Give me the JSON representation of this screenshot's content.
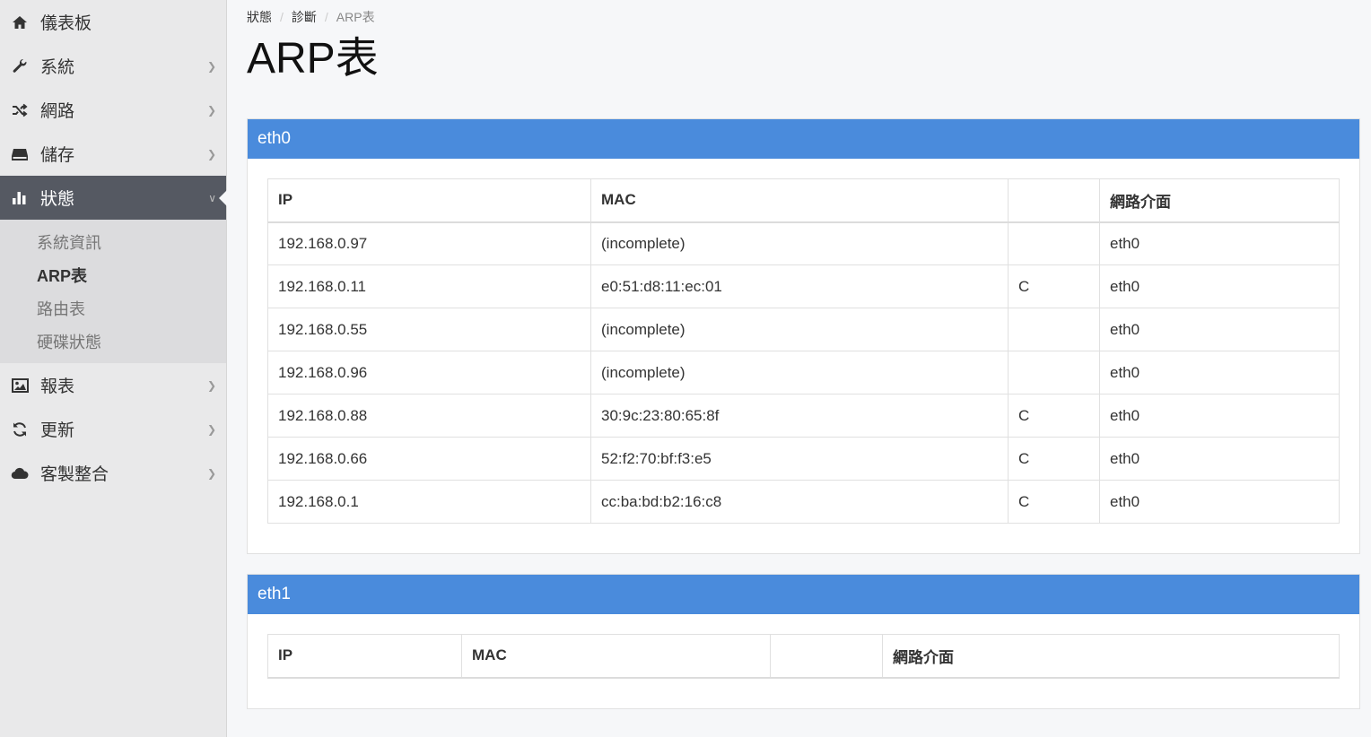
{
  "sidebar": {
    "items": [
      {
        "label": "儀表板",
        "icon": "home-icon"
      },
      {
        "label": "系統",
        "icon": "wrench-icon"
      },
      {
        "label": "網路",
        "icon": "shuffle-icon"
      },
      {
        "label": "儲存",
        "icon": "hdd-icon"
      },
      {
        "label": "狀態",
        "icon": "bar-chart-icon"
      },
      {
        "label": "報表",
        "icon": "image-icon"
      },
      {
        "label": "更新",
        "icon": "refresh-icon"
      },
      {
        "label": "客製整合",
        "icon": "cloud-icon"
      }
    ],
    "submenu": [
      "系統資訊",
      "ARP表",
      "路由表",
      "硬碟狀態"
    ]
  },
  "breadcrumb": {
    "level1": "狀態",
    "level2": "診斷",
    "current": "ARP表",
    "separator": "/"
  },
  "page": {
    "title": "ARP表"
  },
  "panels": [
    {
      "title": "eth0",
      "columns": [
        "IP",
        "MAC",
        "",
        "網路介面"
      ],
      "rows": [
        [
          "192.168.0.97",
          "(incomplete)",
          "",
          "eth0"
        ],
        [
          "192.168.0.11",
          "e0:51:d8:11:ec:01",
          "C",
          "eth0"
        ],
        [
          "192.168.0.55",
          "(incomplete)",
          "",
          "eth0"
        ],
        [
          "192.168.0.96",
          "(incomplete)",
          "",
          "eth0"
        ],
        [
          "192.168.0.88",
          "30:9c:23:80:65:8f",
          "C",
          "eth0"
        ],
        [
          "192.168.0.66",
          "52:f2:70:bf:f3:e5",
          "C",
          "eth0"
        ],
        [
          "192.168.0.1",
          "cc:ba:bd:b2:16:c8",
          "C",
          "eth0"
        ]
      ]
    },
    {
      "title": "eth1",
      "columns": [
        "IP",
        "MAC",
        "",
        "網路介面"
      ],
      "rows": []
    }
  ],
  "colors": {
    "accent": "#4a8bdc",
    "sidebar_active": "#555962"
  }
}
